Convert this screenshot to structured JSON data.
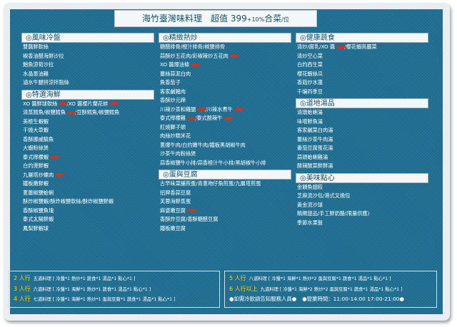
{
  "title": {
    "main": "海竹臺灣味料理　超值 399",
    "small": "+10%",
    "tail": "合菜",
    "per": "/位"
  },
  "sections": {
    "cold": {
      "title": "◎風味冷盤",
      "items": [
        {
          "t": "雙醬鮮軟絲"
        },
        {
          "t": "椒香油醋海鮮沙拉"
        },
        {
          "t": "鮑魚涼筍沙拉"
        },
        {
          "t": "水晶墨油雞"
        },
        {
          "t": "滷水牛腱拼涼拌脂絲"
        }
      ]
    },
    "seafood": {
      "title": "◎特選海鮮",
      "items": [
        {
          "t": "XO 醬鮮球軟絲",
          "f1": true,
          "t2": "/XO 醬櫻片蘭花蚌",
          "f2": true
        },
        {
          "t": "清蒸鱈魚/椒鹽鱈魚",
          "f1": true,
          "t2": "/豆酥鱈魚/椒鹽鱈魚"
        },
        {
          "t": "美極生蝦蝦"
        },
        {
          "t": "干燒大草蝦"
        },
        {
          "t": "香酥挪威鯖魚"
        },
        {
          "t": "大蝦粉絲煲"
        },
        {
          "t": "泰式檸檬蝦",
          "f1": true
        },
        {
          "t": "白灼燙鮮蝦"
        },
        {
          "t": "九層塔炒螺肉",
          "f1": true
        },
        {
          "t": "鐵板嫩鮮蝦"
        },
        {
          "t": "蔥薑椒鹽蛤蜊"
        },
        {
          "t": "酥炸椒鹽蝦/酥炸椒鹽軟絲/酥炸椒鹽鮮蝦"
        },
        {
          "t": "香酥椒鹽魚塊"
        },
        {
          "t": "泰式太陽鮮蝦"
        },
        {
          "t": "鳳梨鮮蝦球"
        }
      ]
    },
    "stirfry": {
      "title": "◎精緻熱炒",
      "items": [
        {
          "t": "糖醋排骨/橙汁排骨/椒鹽排骨"
        },
        {
          "t": "蒜酥炒五花肉/彩椒辣炒五花肉",
          "f1": true
        },
        {
          "t": "XO 醬爆油條",
          "f1": true
        },
        {
          "t": "薑絲蒜泥白肉"
        },
        {
          "t": "魚香茄子"
        },
        {
          "t": "客家鹹豬肉"
        },
        {
          "t": "香酥炒元蹄"
        },
        {
          "t": "川辣沙茶和雞腿",
          "f1": true,
          "t2": "/川辣水煮牛",
          "f2": true
        },
        {
          "t": "泰式檸檬雞",
          "f1": true,
          "t2": "/泰式酸辣牛",
          "f2": true
        },
        {
          "t": "紅燒獅子頭"
        },
        {
          "t": "肉絲炒糯米花"
        },
        {
          "t": "蔥爆牛肉/白灼嫩牛肉/鐵板黑胡椒牛肉"
        },
        {
          "t": "沙茶牛肉粉絲煲"
        },
        {
          "t": "蒜香椒鹽牛小排/蒜香極汁牛小排/黑胡椒牛小排"
        }
      ]
    },
    "eggtofu": {
      "title": "◎蛋與豆腐",
      "items": [
        {
          "t": "古早味菜脯煎蛋/青蔥吻仔魚煎蛋/九層塔煎蛋"
        },
        {
          "t": "招牌香蒜豆腐"
        },
        {
          "t": "芙蓉海鮮蒸蛋"
        },
        {
          "t": "麻婆嫩豆腐",
          "f1": true
        },
        {
          "t": "香酥炸豆腐/香酥糖醋豆腐"
        },
        {
          "t": "鐵板嫩豆腐"
        }
      ]
    },
    "veg": {
      "title": "◎健康蔬食",
      "items": [
        {
          "t": "清炒/腐乳/XO 醬",
          "f1": true,
          "t2": "/櫻花蝦高麗菜"
        },
        {
          "t": "清炒空心菜"
        },
        {
          "t": "白灼西生菜"
        },
        {
          "t": "櫻花蝦絲瓜"
        },
        {
          "t": "香菇炒水蓮"
        },
        {
          "t": "干煸四季豆"
        }
      ]
    },
    "soup": {
      "title": "◎道地湯品",
      "items": [
        {
          "t": "清燉蛤蜊湯"
        },
        {
          "t": "味噌鮮魚湯"
        },
        {
          "t": "客家鹹菜白肉湯"
        },
        {
          "t": "薑絲沙茶牛肉湯"
        },
        {
          "t": "番茄豆腐蛋花湯"
        },
        {
          "t": "蒜頭蛤蜊雞湯"
        },
        {
          "t": "酸辣酸菜鮮鮮湯"
        }
      ]
    },
    "dessert": {
      "title": "◎美味點心",
      "items": [
        {
          "t": "金饋魚翅餃"
        },
        {
          "t": "芝麻流沙包/港式叉燒包"
        },
        {
          "t": "黃金流沙球"
        },
        {
          "t": "精緻甜品/手工鮮奶酪(限量供應)"
        },
        {
          "t": "季節水果盤"
        }
      ]
    }
  },
  "footer": {
    "left": [
      {
        "label": "2 人行",
        "text": "五道料理 [ 冷盤*1  熱炒*1  蔬食*1  湯品*1  點心*1 ]"
      },
      {
        "label": "3 人行",
        "text": "六道料理 [ 冷盤*1  海鮮*1  熱炒*1  蔬食*1  湯品*1  點心*1 ]"
      },
      {
        "label": "4 人行",
        "text": "七道料理 [ 冷盤*1  海鮮*1  熱炒*1  蛋與豆腐*1  蔬食*1  湯品*1  點心*1 ]"
      }
    ],
    "right": [
      {
        "label": "5 人行",
        "text": "八道料理 [ 冷盤*1  海鮮*1  熱炒*2  蛋與豆腐*1  蔬食*1  湯品*1  點心*1 ]"
      },
      {
        "label": "6 人行以上",
        "text": "九道料理 [ 冷盤*1  海鮮*2  熱炒*2  蛋與豆腐*1  蔬食*1  湯品*1  點心*1 ]"
      },
      {
        "note": "●如需冷飲請告知服務人員●",
        "hours": "●營業時間：11:00-14:00  17:00-21:00●"
      }
    ]
  },
  "colors": {
    "panel": "#1f6f93",
    "accent": "#ffd21c",
    "fish": "#c0392b",
    "header_text": "#12506d"
  }
}
